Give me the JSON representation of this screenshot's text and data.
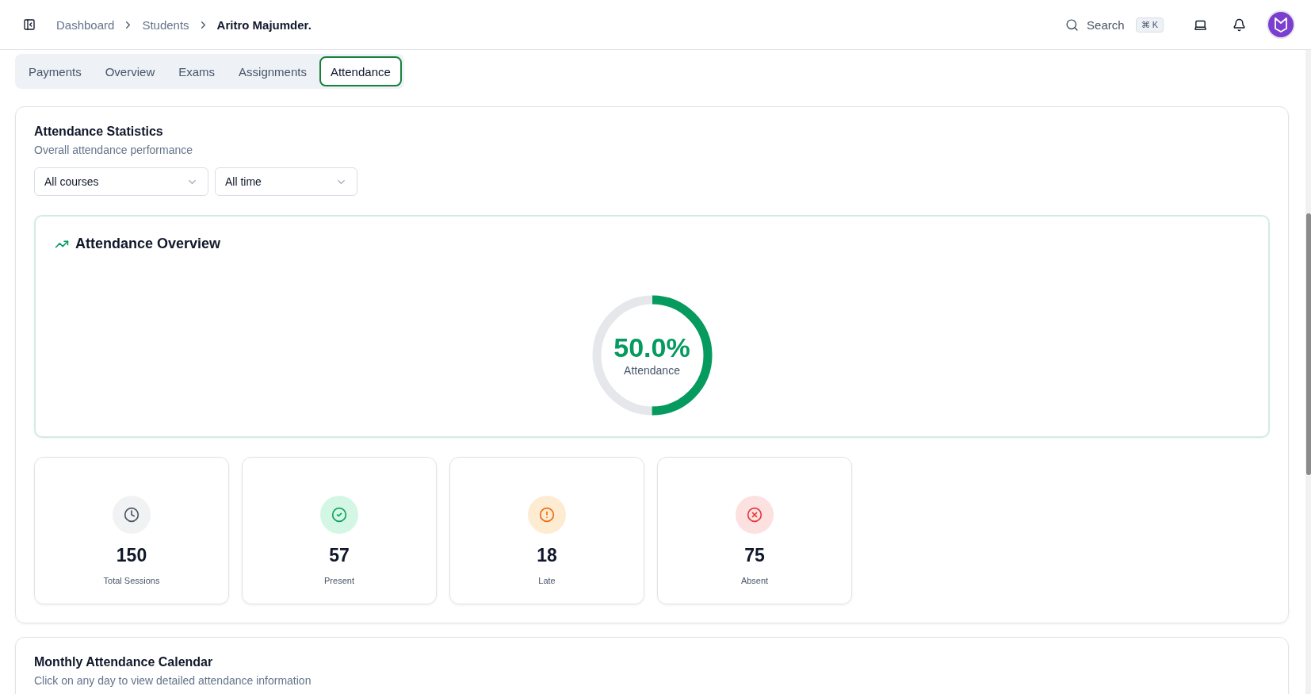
{
  "breadcrumb": [
    {
      "label": "Dashboard",
      "current": false
    },
    {
      "label": "Students",
      "current": false
    },
    {
      "label": "Aritro Majumder.",
      "current": true
    }
  ],
  "search": {
    "label": "Search",
    "shortcut": "⌘ K"
  },
  "tabs": [
    {
      "label": "Payments",
      "selected": false
    },
    {
      "label": "Overview",
      "selected": false
    },
    {
      "label": "Exams",
      "selected": false
    },
    {
      "label": "Assignments",
      "selected": false
    },
    {
      "label": "Attendance",
      "selected": true
    }
  ],
  "statistics": {
    "title": "Attendance Statistics",
    "subtitle": "Overall attendance performance",
    "filters": [
      {
        "value": "All courses"
      },
      {
        "value": "All time"
      }
    ],
    "overview": {
      "title": "Attendance Overview",
      "level": 0.5,
      "percent": "50.0%",
      "label": "Attendance"
    },
    "stats": [
      {
        "kind": "total",
        "value": "150",
        "label": "Total Sessions"
      },
      {
        "kind": "present",
        "value": "57",
        "label": "Present"
      },
      {
        "kind": "late",
        "value": "18",
        "label": "Late"
      },
      {
        "kind": "absent",
        "value": "75",
        "label": "Absent"
      }
    ]
  },
  "calendar": {
    "title": "Monthly Attendance Calendar",
    "subtitle": "Click on any day to view detailed attendance information"
  }
}
